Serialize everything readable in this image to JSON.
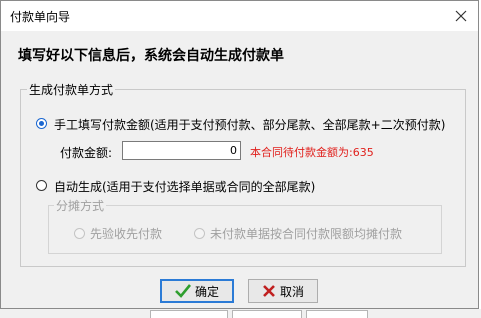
{
  "window": {
    "title": "付款单向导",
    "close_icon": "close-icon"
  },
  "header": {
    "instruction": "填写好以下信息后，系统会自动生成付款单"
  },
  "payment_method": {
    "group_title": "生成付款单方式",
    "manual_option": {
      "label": "手工填写付款金额(适用于支付预付款、部分尾款、全部尾款+二次预付款)",
      "selected": true
    },
    "amount_label": "付款金额:",
    "amount_value": "0",
    "contract_pending_note": "本合同待付款金额为:635",
    "auto_option": {
      "label": "自动生成(适用于支付选择单据或合同的全部尾款)",
      "selected": false
    },
    "allocation": {
      "group_title": "分摊方式",
      "option_first_inspected": "先验收先付款",
      "option_proportional": "未付款单据按合同付款限额均摊付款"
    }
  },
  "footer": {
    "ok_label": "确定",
    "cancel_label": "取消"
  },
  "colors": {
    "accent": "#1a66d0",
    "warning_text": "#e0201c",
    "ok_check": "#2e9e2e",
    "cancel_x": "#c02020"
  }
}
